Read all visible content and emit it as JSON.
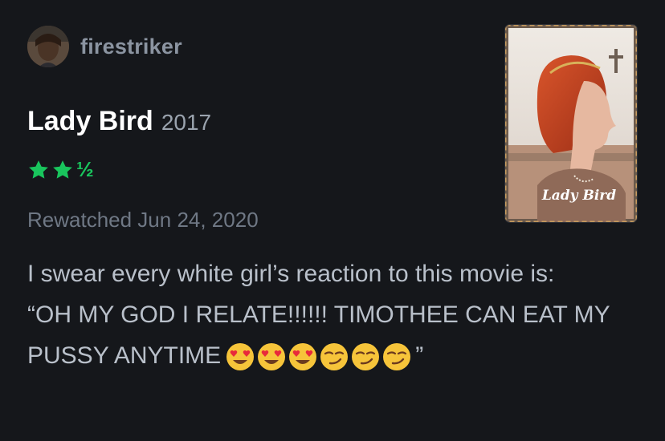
{
  "user": {
    "username": "firestriker",
    "avatar_icon": "user-avatar"
  },
  "film": {
    "title": "Lady Bird",
    "year": "2017",
    "poster_title": "Lady Bird"
  },
  "rating": {
    "stars": 2.5,
    "max": 5,
    "half_symbol": "½",
    "color": "#19c55d"
  },
  "watch": {
    "label": "Rewatched Jun 24, 2020"
  },
  "review": {
    "line1": "I swear every white girl’s reaction to this movie is:",
    "line2": "“OH MY GOD I RELATE!!!!!! TIMOTHEE CAN EAT MY PUSSY ANYTIME",
    "closing_quote": "”",
    "emojis": [
      "heart-eyes-emoji",
      "heart-eyes-emoji",
      "heart-eyes-emoji",
      "smirk-emoji",
      "smirk-emoji",
      "smirk-emoji"
    ]
  },
  "colors": {
    "background": "#15171b",
    "username": "#8b94a1",
    "muted": "#6f7885",
    "body_text": "#b9c0ca",
    "accent_green": "#19c55d"
  }
}
